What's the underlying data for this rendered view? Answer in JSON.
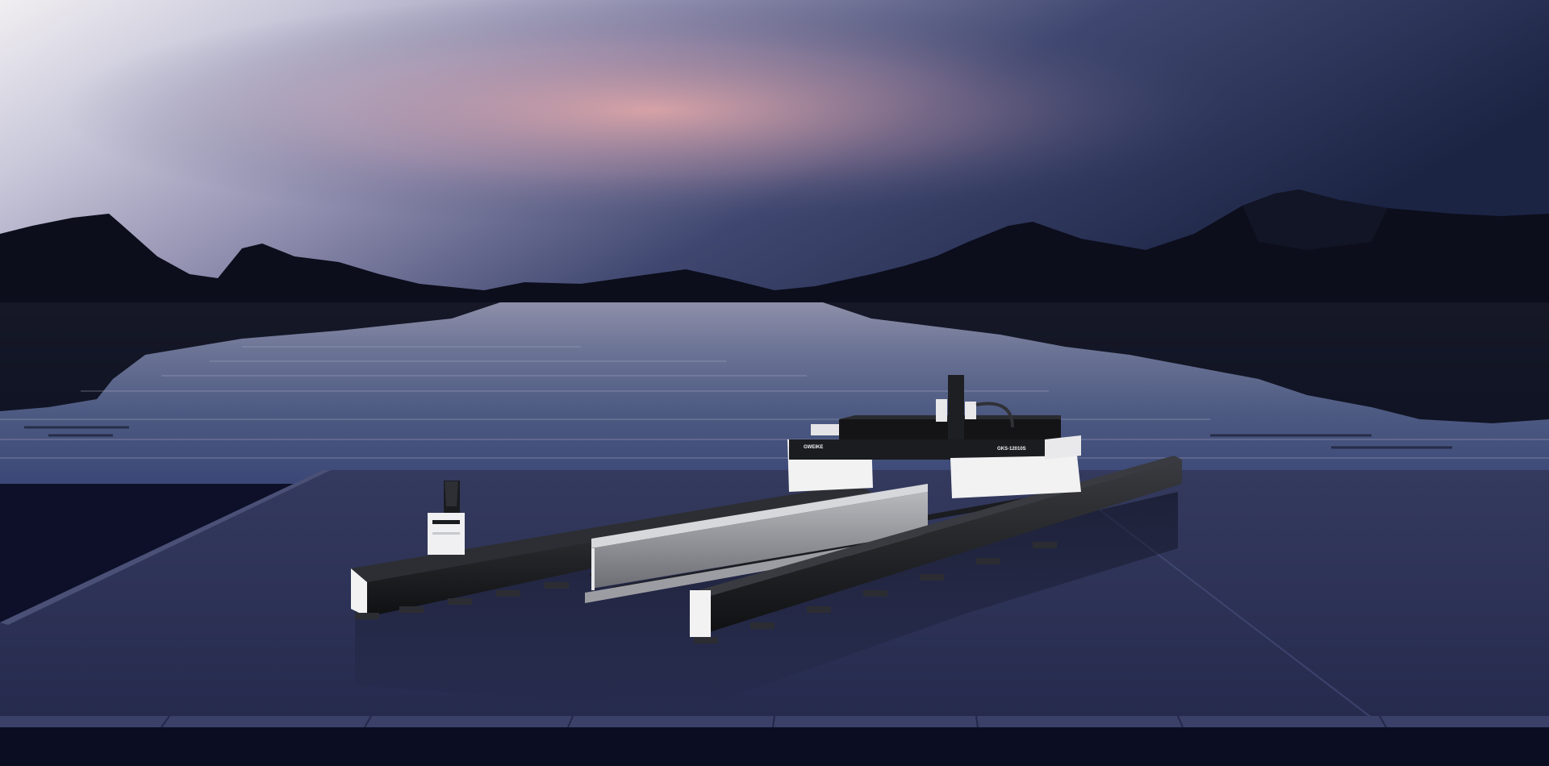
{
  "scene": {
    "description_type": "product-render",
    "colors": {
      "sky_top": "#1f2a48",
      "sky_glow_left": "#eeeaf0",
      "sky_glow_pink": "#d9a9ad",
      "mountains": "#0c0e1c",
      "water": "#5f6b90",
      "platform": "#2b3156",
      "platform_edge": "#4a5076",
      "foot_strip": "#0b0d22",
      "machine_black": "#141416",
      "machine_white": "#f2f2f2",
      "machine_grey": "#7d7f85"
    }
  },
  "machine": {
    "brand_label": "GWEIKE",
    "model_label": "GKS-12010S"
  }
}
